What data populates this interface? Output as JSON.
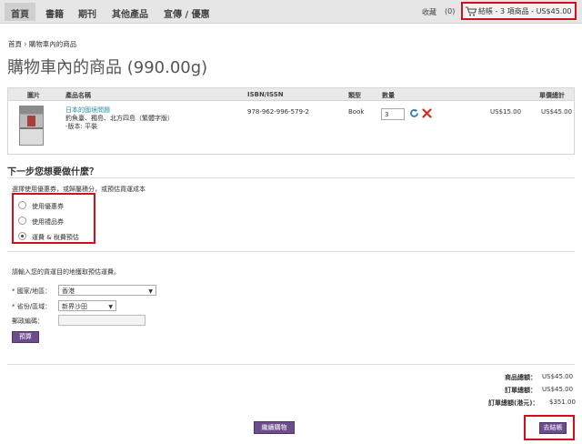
{
  "nav": {
    "items": [
      "首頁",
      "書籍",
      "期刊",
      "其他產品",
      "宣傳 / 優惠"
    ],
    "favorites_label": "收藏",
    "favorites_count": "(0)",
    "cart_summary": "結帳 - 3 項商品 - US$45.00"
  },
  "breadcrumb": "首頁 › 購物車內的商品",
  "page_title": "購物車內的商品 (990.00g)",
  "table": {
    "headers": {
      "image": "圖片",
      "name": "產品名稱",
      "isbn": "ISBN/ISSN",
      "type": "類型",
      "qty": "數量",
      "unit_price": "單價",
      "total": "總計"
    },
    "row": {
      "title": "日本的國境問題",
      "subtitle": "釣魚臺、獨島、北方四島（繁體字版）",
      "edition": "-版本: 平裝",
      "isbn": "978-962-996-579-2",
      "type": "Book",
      "qty": "3",
      "unit_price": "US$15.00",
      "total": "US$45.00"
    }
  },
  "next_step": {
    "heading": "下一步您想要做什麼？",
    "description": "選擇使用優惠券，或歸屬積分，或預估貨運成本",
    "options": [
      "使用優惠券",
      "使用禮品券",
      "運費 & 稅費預估"
    ],
    "selected_index": 2
  },
  "shipping": {
    "description": "請輸入您的貨運目的地獲取預估運費。",
    "country_label": "* 國家/地區：",
    "country_value": "香港",
    "region_label": "* 省份/區域：",
    "region_value": "新界沙田",
    "postcode_label": "郵政編碼：",
    "postcode_value": "",
    "estimate_button": "預算"
  },
  "totals": {
    "subtotal_label": "商品總額：",
    "subtotal_value": "US$45.00",
    "order_total_label": "訂單總額：",
    "order_total_value": "US$45.00",
    "order_total_hkd_label": "訂單總額(港元)：",
    "order_total_hkd_value": "$351.00"
  },
  "buttons": {
    "continue_shopping": "繼續購物",
    "checkout": "去結帳"
  },
  "colors": {
    "accent_purple": "#6c4c8c",
    "highlight_red": "#d0101c",
    "link_teal": "#2c8fa8",
    "topbar": "#e6e6e6"
  }
}
